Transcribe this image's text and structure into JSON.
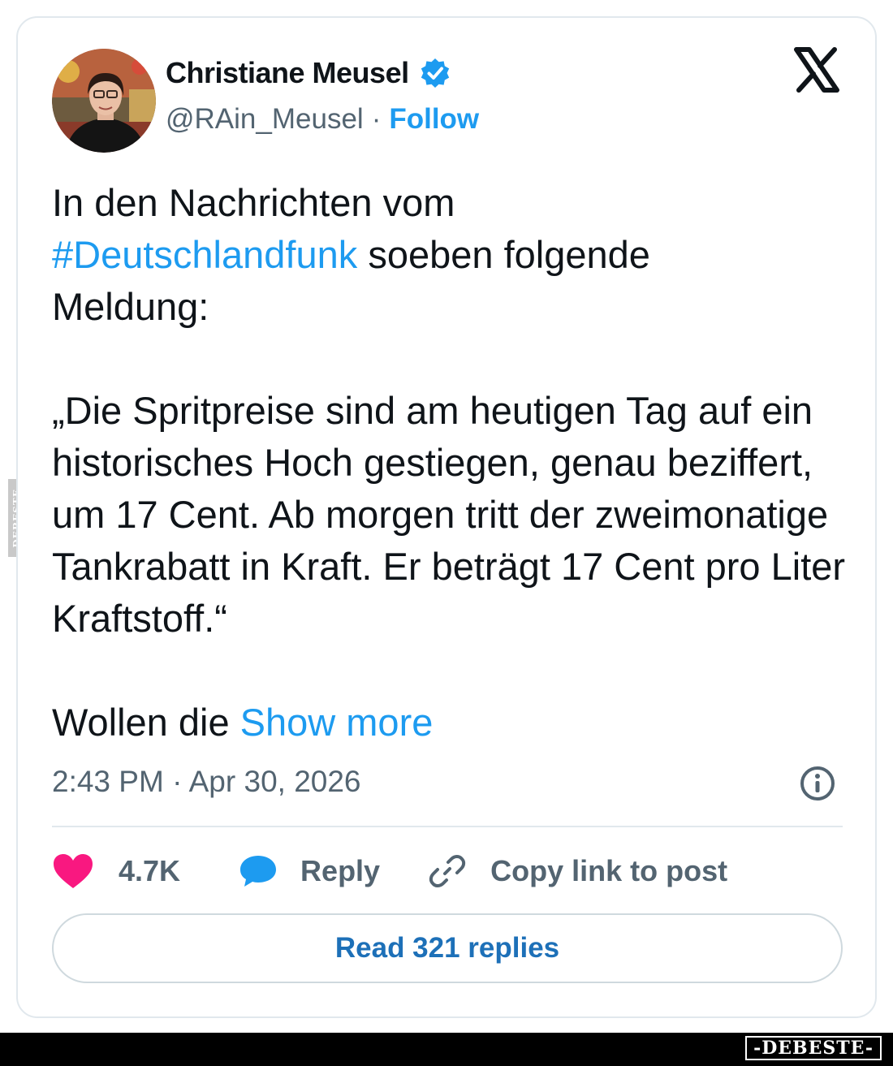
{
  "watermark": {
    "side_text": "DEBESTE",
    "footer_text": "-DEBESTE-"
  },
  "author": {
    "name": "Christiane Meusel",
    "handle": "@RAin_Meusel",
    "separator": "·",
    "follow_label": "Follow",
    "avatar_icon": "profile-photo",
    "verified_icon": "verified-badge-icon"
  },
  "platform": {
    "logo_icon": "x-logo-icon"
  },
  "post": {
    "line1": "In den Nachrichten vom",
    "hashtag": "#Deutschlandfunk",
    "line2_rest": " soeben folgende",
    "line3": "Meldung:",
    "quote": "„Die Spritpreise sind am heutigen Tag auf ein historisches Hoch gestiegen, genau beziffert, um 17 Cent. Ab morgen tritt der zweimonatige Tankrabatt in Kraft. Er beträgt 17 Cent pro Liter Kraftstoff.“",
    "truncated_start": "Wollen die ",
    "show_more_label": "Show more",
    "timestamp": "2:43 PM · Apr 30, 2026"
  },
  "actions": {
    "likes_count": "4.7K",
    "reply_label": "Reply",
    "copy_link_label": "Copy link to post",
    "read_replies_label": "Read 321 replies"
  },
  "colors": {
    "accent_blue": "#1d9bf0",
    "heart_pink": "#f91880",
    "text_primary": "#0f1419",
    "text_secondary": "#536471",
    "border": "#e1e8ed"
  }
}
